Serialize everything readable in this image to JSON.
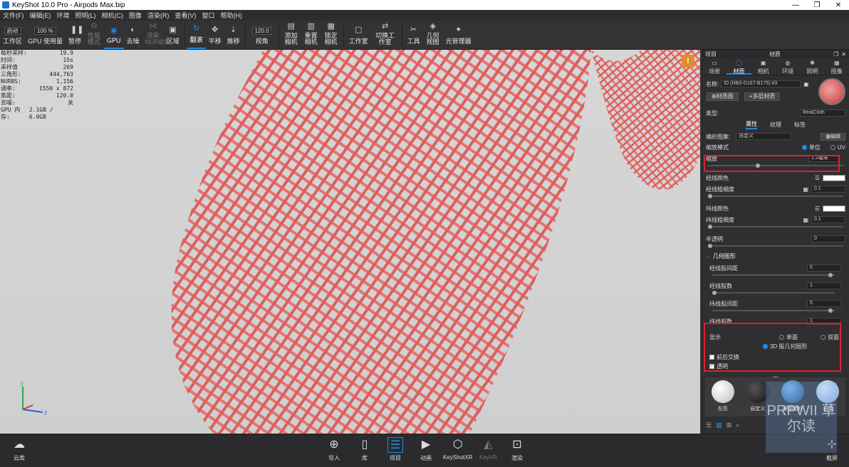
{
  "window": {
    "title": "KeyShot 10.0 Pro  - Airpods Max.bip",
    "minimize": "—",
    "maximize": "❐",
    "close": "✕"
  },
  "menu": [
    "文件(F)",
    "编辑(E)",
    "环境",
    "照明(L)",
    "相机(C)",
    "图像",
    "渲染(R)",
    "查看(V)",
    "窗口",
    "帮助(H)"
  ],
  "toolbar": {
    "mode_value": "启动",
    "percent_value": "100 %",
    "fov_value": "120.0",
    "items": [
      {
        "label": "工作区",
        "icon": "workspace-icon",
        "state": "normal"
      },
      {
        "label": "GPU 使用量",
        "icon": "gpu-usage-icon",
        "state": "normal"
      },
      {
        "label": "暂停",
        "icon": "pause-icon",
        "state": "normal"
      },
      {
        "label": "性能模式",
        "icon": "performance-icon",
        "state": "dim"
      },
      {
        "label": "GPU",
        "icon": "gpu-icon",
        "state": "active"
      },
      {
        "label": "去噪",
        "icon": "denoise-icon",
        "state": "normal"
      },
      {
        "label": "渲染 NURBS",
        "icon": "nurbs-icon",
        "state": "dim"
      },
      {
        "label": "区域",
        "icon": "region-icon",
        "state": "normal"
      },
      {
        "label": "翻滚",
        "icon": "tumble-icon",
        "state": "active"
      },
      {
        "label": "平移",
        "icon": "pan-icon",
        "state": "normal"
      },
      {
        "label": "推移",
        "icon": "dolly-icon",
        "state": "normal"
      },
      {
        "label": "视角",
        "icon": "fov-icon",
        "state": "normal"
      },
      {
        "label": "添加相机",
        "icon": "add-camera-icon",
        "state": "normal"
      },
      {
        "label": "重置相机",
        "icon": "reset-camera-icon",
        "state": "normal"
      },
      {
        "label": "锁定相机",
        "icon": "lock-camera-icon",
        "state": "normal"
      },
      {
        "label": "工作室",
        "icon": "studio-icon",
        "state": "normal"
      },
      {
        "label": "切换工作室",
        "icon": "switch-studio-icon",
        "state": "normal"
      },
      {
        "label": "工具",
        "icon": "tools-icon",
        "state": "normal"
      },
      {
        "label": "几何视图",
        "icon": "geometry-view-icon",
        "state": "normal"
      },
      {
        "label": "光管理器",
        "icon": "light-manager-icon",
        "state": "normal"
      }
    ]
  },
  "stats": [
    {
      "k": "每秒采样:",
      "v": "19.9"
    },
    {
      "k": "时间:",
      "v": "15s"
    },
    {
      "k": "采样值",
      "v": "269"
    },
    {
      "k": "三角形:",
      "v": "444,763"
    },
    {
      "k": "NURBS:",
      "v": "1,156"
    },
    {
      "k": "调率:",
      "v": "1550 x 872"
    },
    {
      "k": "焦距:",
      "v": "120.0"
    },
    {
      "k": "去噪:",
      "v": "关"
    },
    {
      "k": "GPU 内存:",
      "v": "2.1GB / 6.0GB"
    }
  ],
  "axis": {
    "y": "y",
    "z": "z"
  },
  "panel": {
    "header_left": "项目",
    "header_title": "材质",
    "tabs": [
      "场景",
      "材质",
      "相机",
      "环境",
      "照明",
      "图像"
    ],
    "name_label": "名称:",
    "name_value": "ID (HB3-G167-B175) #3",
    "material_graph_btn": "材质图",
    "multi_material_btn": "多层材质",
    "type_label": "类型:",
    "type_value": "RealCloth",
    "subtabs": [
      "属性",
      "纹理",
      "标签"
    ],
    "pattern_label": "编织图案:",
    "pattern_value": "自定义",
    "edit_btn": "编辑",
    "scale_mode_label": "缩放模式",
    "scale_unit": "单位",
    "scale_uv": "UV",
    "scale_label": "缩放",
    "scale_value": "1.2毫米",
    "warp_color_label": "经线颜色",
    "warp_thick_label": "经线粗细度",
    "warp_thick_value": "0.1",
    "weft_color_label": "纬线颜色",
    "weft_thick_label": "纬线粗细度",
    "weft_thick_value": "0.1",
    "transp_label": "半透明",
    "transp_value": "0",
    "geometry_section": "几何图形",
    "warp_spacing_label": "经线股间距",
    "warp_spacing_value": "5",
    "warp_count_label": "经线股数",
    "warp_count_value": "1",
    "weft_spacing_label": "纬线股间距",
    "weft_spacing_value": "5",
    "weft_count_label": "纬线股数",
    "weft_count_value": "1",
    "display_label": "显示",
    "single_side": "单面",
    "double_side": "双面",
    "geo3d": "3D 股几何图形",
    "swap_label": "前后交换",
    "transparent_label": "透明"
  },
  "library": [
    {
      "label": "左页",
      "color": "#e8e8e8"
    },
    {
      "label": "自定义",
      "color": "#202020"
    },
    {
      "label": "硬钢塑料",
      "color": "#2c6fa8"
    },
    {
      "label": "右页",
      "color": "#9fc4e6"
    }
  ],
  "bottom": {
    "cloud": "云库",
    "items": [
      {
        "label": "导入",
        "icon": "import-icon",
        "state": "normal"
      },
      {
        "label": "库",
        "icon": "library-icon",
        "state": "normal"
      },
      {
        "label": "项目",
        "icon": "project-icon",
        "state": "on"
      },
      {
        "label": "动画",
        "icon": "animation-icon",
        "state": "normal"
      },
      {
        "label": "KeyShotXR",
        "icon": "keyshotxr-icon",
        "state": "normal"
      },
      {
        "label": "KeyVR",
        "icon": "keyvr-icon",
        "state": "dim"
      },
      {
        "label": "渲染",
        "icon": "render-icon",
        "state": "normal"
      }
    ],
    "screenshot": "截屏"
  },
  "watermark": "PRPWII 草尔读",
  "colors": {
    "accent": "#1c8ae6",
    "mesh": "#e8726f",
    "highlight": "#e0202c"
  }
}
